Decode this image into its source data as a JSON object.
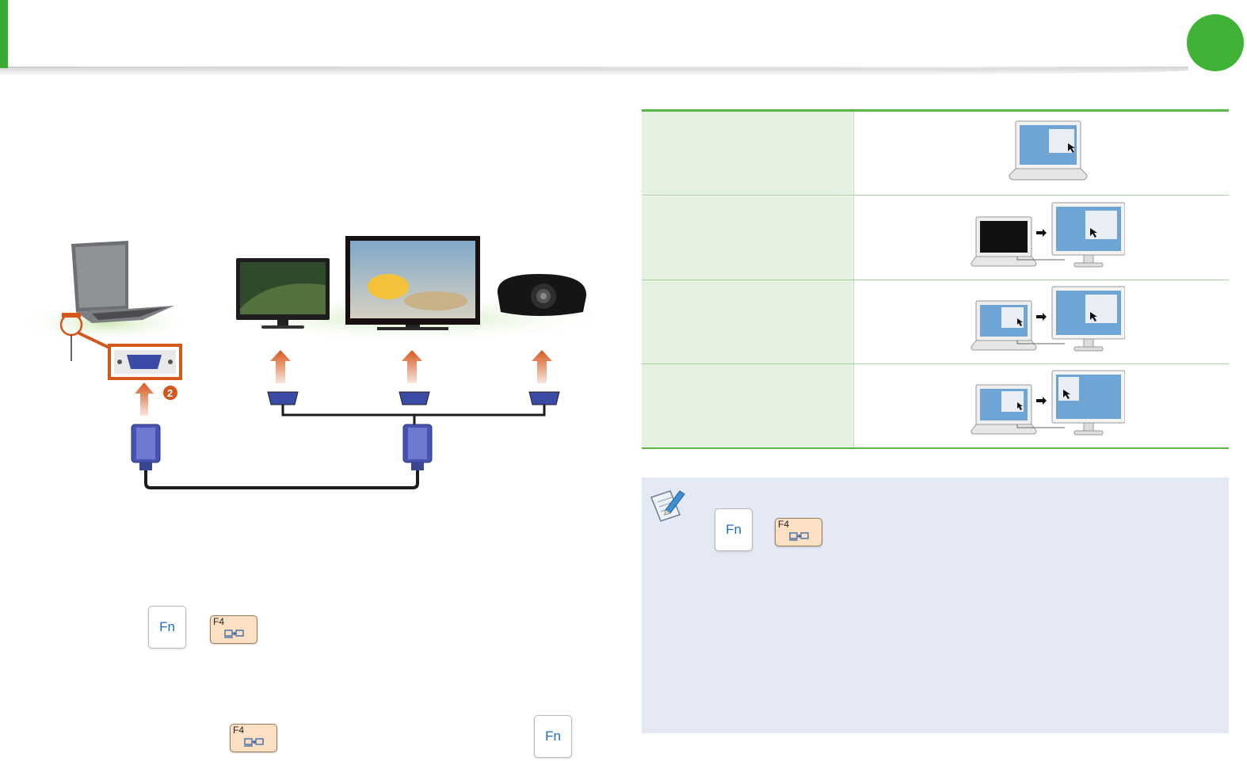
{
  "keys": {
    "fn": "Fn",
    "f4": "F4"
  },
  "colors": {
    "accent_green": "#3aaa35",
    "table_left_fill": "#e6f2e1",
    "note_fill": "#e5e9f5",
    "arrow": "#d4571c",
    "connector": "#4a55a8"
  },
  "icons": {
    "note": "pencil-notepad-icon",
    "display_mode": "display-switch-icon",
    "callout_2": "2"
  },
  "table": {
    "rows": [
      {
        "image": "laptop-screen-only"
      },
      {
        "image": "laptop-off-monitor-on"
      },
      {
        "image": "laptop-and-monitor-clone"
      },
      {
        "image": "laptop-and-monitor-dual"
      }
    ]
  }
}
